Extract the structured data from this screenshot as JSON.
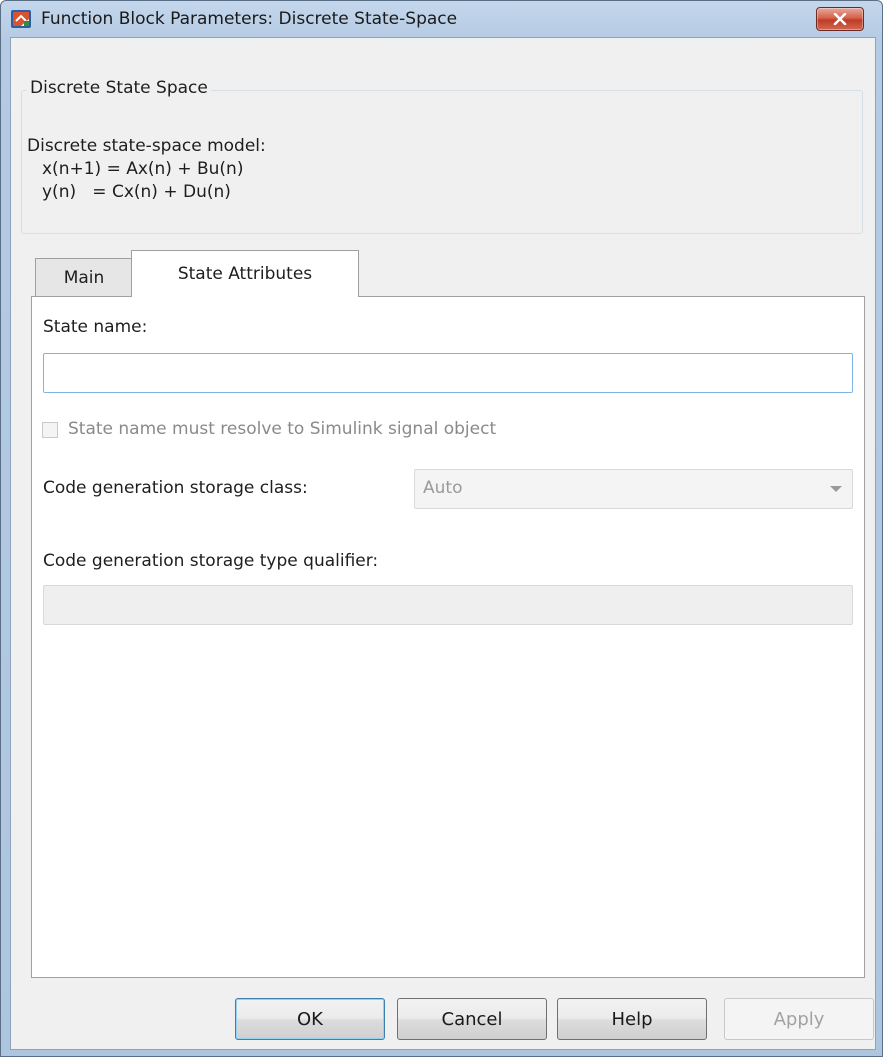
{
  "window": {
    "title": "Function Block Parameters: Discrete State-Space",
    "icon": "simulink-block-icon",
    "close_icon": "close-icon"
  },
  "block": {
    "name": "Discrete State Space",
    "description": [
      "Discrete state-space model:",
      "x(n+1) = Ax(n) + Bu(n)",
      "y(n)   = Cx(n) + Du(n)"
    ]
  },
  "tabs": [
    {
      "label": "Main",
      "active": false
    },
    {
      "label": "State Attributes",
      "active": true
    }
  ],
  "state_attributes": {
    "state_name_label": "State name:",
    "state_name_value": "",
    "resolve_checkbox_label": "State name must resolve to Simulink signal object",
    "resolve_checked": false,
    "storage_class_label": "Code generation storage class:",
    "storage_class_value": "Auto",
    "type_qualifier_label": "Code generation storage type qualifier:",
    "type_qualifier_value": ""
  },
  "buttons": {
    "ok": "OK",
    "cancel": "Cancel",
    "help": "Help",
    "apply": "Apply"
  },
  "colors": {
    "titlebar": "#b9cee6",
    "close_button": "#c9452d",
    "dialog_bg": "#f0f0f0",
    "focus_border": "#7eb4ea",
    "disabled_text": "#8a8a8a"
  }
}
